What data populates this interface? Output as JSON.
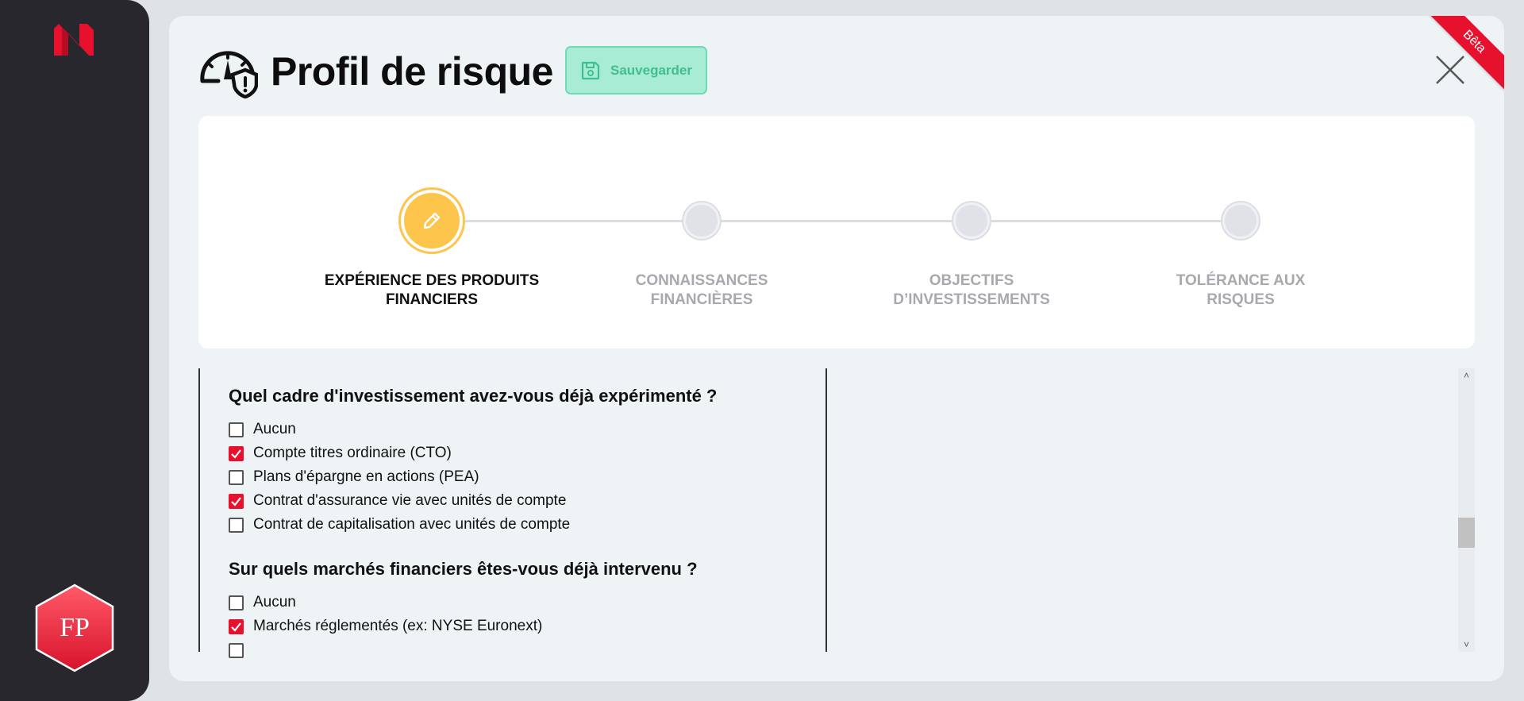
{
  "app": {
    "beta_label": "Bêta",
    "avatar_initials": "FP"
  },
  "header": {
    "title": "Profil de risque",
    "save_label": "Sauvegarder"
  },
  "stepper": {
    "steps": [
      {
        "label_line1": "EXPÉRIENCE DES PRODUITS",
        "label_line2": "FINANCIERS",
        "active": true
      },
      {
        "label_line1": "CONNAISSANCES",
        "label_line2": "FINANCIÈRES",
        "active": false
      },
      {
        "label_line1": "OBJECTIFS",
        "label_line2": "D’INVESTISSEMENTS",
        "active": false
      },
      {
        "label_line1": "TOLÉRANCE AUX",
        "label_line2": "RISQUES",
        "active": false
      }
    ]
  },
  "questions": [
    {
      "title": "Quel cadre d'investissement avez-vous déjà expérimenté ?",
      "options": [
        {
          "label": "Aucun",
          "checked": false
        },
        {
          "label": "Compte titres ordinaire (CTO)",
          "checked": true
        },
        {
          "label": "Plans d'épargne en actions (PEA)",
          "checked": false
        },
        {
          "label": "Contrat d'assurance vie avec unités de compte",
          "checked": true
        },
        {
          "label": "Contrat de capitalisation avec unités de compte",
          "checked": false
        }
      ]
    },
    {
      "title": "Sur quels marchés financiers êtes-vous déjà intervenu ?",
      "options": [
        {
          "label": "Aucun",
          "checked": false
        },
        {
          "label": "Marchés réglementés (ex: NYSE Euronext)",
          "checked": true
        }
      ]
    }
  ],
  "colors": {
    "accent_red": "#e8112d",
    "active_step": "#fdc54b",
    "save_bg": "#a8ecd6",
    "save_text": "#3fbf8e",
    "sidebar_bg": "#27272d"
  }
}
